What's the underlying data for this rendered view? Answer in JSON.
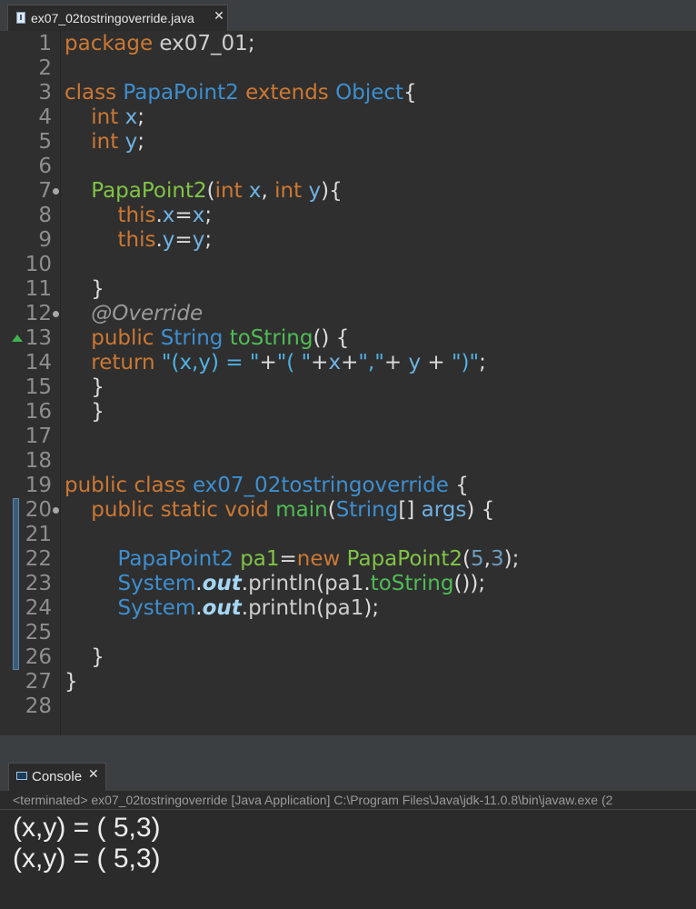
{
  "editor": {
    "tab_label": "ex07_02tostringoverride.java",
    "close_glyph": "✕",
    "lines": [
      {
        "n": "1",
        "tokens": [
          [
            "kw",
            "package"
          ],
          [
            "pl",
            " "
          ],
          [
            "id",
            "ex07_01"
          ],
          [
            "pl",
            ";"
          ]
        ]
      },
      {
        "n": "2",
        "tokens": []
      },
      {
        "n": "3",
        "tokens": [
          [
            "kw",
            "class"
          ],
          [
            "pl",
            " "
          ],
          [
            "cls",
            "PapaPoint2"
          ],
          [
            "pl",
            " "
          ],
          [
            "kw",
            "extends"
          ],
          [
            "pl",
            " "
          ],
          [
            "cls",
            "Object"
          ],
          [
            "pl",
            "{"
          ]
        ]
      },
      {
        "n": "4",
        "tokens": [
          [
            "pl",
            "    "
          ],
          [
            "kw",
            "int"
          ],
          [
            "pl",
            " "
          ],
          [
            "fld",
            "x"
          ],
          [
            "pl",
            ";"
          ]
        ]
      },
      {
        "n": "5",
        "tokens": [
          [
            "pl",
            "    "
          ],
          [
            "kw",
            "int"
          ],
          [
            "pl",
            " "
          ],
          [
            "fld",
            "y"
          ],
          [
            "pl",
            ";"
          ]
        ]
      },
      {
        "n": "6",
        "tokens": []
      },
      {
        "n": "7",
        "tokens": [
          [
            "pl",
            "    "
          ],
          [
            "ctor",
            "PapaPoint2"
          ],
          [
            "pl",
            "("
          ],
          [
            "kw",
            "int"
          ],
          [
            "pl",
            " "
          ],
          [
            "fld",
            "x"
          ],
          [
            "pl",
            ", "
          ],
          [
            "kw",
            "int"
          ],
          [
            "pl",
            " "
          ],
          [
            "fld",
            "y"
          ],
          [
            "pl",
            "){"
          ]
        ]
      },
      {
        "n": "8",
        "tokens": [
          [
            "pl",
            "        "
          ],
          [
            "kw",
            "this"
          ],
          [
            "pl",
            "."
          ],
          [
            "fld",
            "x"
          ],
          [
            "pl",
            "="
          ],
          [
            "fld",
            "x"
          ],
          [
            "pl",
            ";"
          ]
        ]
      },
      {
        "n": "9",
        "tokens": [
          [
            "pl",
            "        "
          ],
          [
            "kw",
            "this"
          ],
          [
            "pl",
            "."
          ],
          [
            "fld",
            "y"
          ],
          [
            "pl",
            "="
          ],
          [
            "fld",
            "y"
          ],
          [
            "pl",
            ";"
          ]
        ]
      },
      {
        "n": "10",
        "tokens": []
      },
      {
        "n": "11",
        "tokens": [
          [
            "pl",
            "    }"
          ]
        ]
      },
      {
        "n": "12",
        "tokens": [
          [
            "pl",
            "    "
          ],
          [
            "ann",
            "@Override"
          ]
        ]
      },
      {
        "n": "13",
        "tokens": [
          [
            "pl",
            "    "
          ],
          [
            "kw",
            "public"
          ],
          [
            "pl",
            " "
          ],
          [
            "cls",
            "String"
          ],
          [
            "pl",
            " "
          ],
          [
            "mth",
            "toString"
          ],
          [
            "pl",
            "() {"
          ]
        ]
      },
      {
        "n": "14",
        "tokens": [
          [
            "pl",
            "    "
          ],
          [
            "kw",
            "return"
          ],
          [
            "pl",
            " "
          ],
          [
            "str",
            "\"(x,y) = \""
          ],
          [
            "pl",
            "+"
          ],
          [
            "str",
            "\"( \""
          ],
          [
            "pl",
            "+"
          ],
          [
            "fld",
            "x"
          ],
          [
            "pl",
            "+"
          ],
          [
            "str",
            "\",\""
          ],
          [
            "pl",
            "+ "
          ],
          [
            "fld",
            "y"
          ],
          [
            "pl",
            " + "
          ],
          [
            "str",
            "\")\""
          ],
          [
            "pl",
            ";"
          ]
        ]
      },
      {
        "n": "15",
        "tokens": [
          [
            "pl",
            "    }"
          ]
        ]
      },
      {
        "n": "16",
        "tokens": [
          [
            "pl",
            "    }"
          ]
        ]
      },
      {
        "n": "17",
        "tokens": []
      },
      {
        "n": "18",
        "tokens": []
      },
      {
        "n": "19",
        "tokens": [
          [
            "kw",
            "public"
          ],
          [
            "pl",
            " "
          ],
          [
            "kw",
            "class"
          ],
          [
            "pl",
            " "
          ],
          [
            "cls",
            "ex07_02tostringoverride"
          ],
          [
            "pl",
            " {"
          ]
        ]
      },
      {
        "n": "20",
        "tokens": [
          [
            "pl",
            "    "
          ],
          [
            "kw",
            "public"
          ],
          [
            "pl",
            " "
          ],
          [
            "kw",
            "static"
          ],
          [
            "pl",
            " "
          ],
          [
            "kw",
            "void"
          ],
          [
            "pl",
            " "
          ],
          [
            "mth",
            "main"
          ],
          [
            "pl",
            "("
          ],
          [
            "cls",
            "String"
          ],
          [
            "pl",
            "[] "
          ],
          [
            "fld",
            "args"
          ],
          [
            "pl",
            ") {"
          ]
        ]
      },
      {
        "n": "21",
        "tokens": []
      },
      {
        "n": "22",
        "tokens": [
          [
            "pl",
            "        "
          ],
          [
            "cls",
            "PapaPoint2"
          ],
          [
            "pl",
            " "
          ],
          [
            "ctor",
            "pa1"
          ],
          [
            "pl",
            "="
          ],
          [
            "kw",
            "new"
          ],
          [
            "pl",
            " "
          ],
          [
            "ctor",
            "PapaPoint2"
          ],
          [
            "pl",
            "("
          ],
          [
            "num",
            "5"
          ],
          [
            "pl",
            ","
          ],
          [
            "num",
            "3"
          ],
          [
            "pl",
            ");"
          ]
        ]
      },
      {
        "n": "23",
        "tokens": [
          [
            "pl",
            "        "
          ],
          [
            "cls",
            "System"
          ],
          [
            "pl",
            "."
          ],
          [
            "sout",
            "out"
          ],
          [
            "pl",
            "."
          ],
          [
            "id",
            "println"
          ],
          [
            "pl",
            "("
          ],
          [
            "id",
            "pa1"
          ],
          [
            "pl",
            "."
          ],
          [
            "mth",
            "toString"
          ],
          [
            "pl",
            "());"
          ]
        ]
      },
      {
        "n": "24",
        "tokens": [
          [
            "pl",
            "        "
          ],
          [
            "cls",
            "System"
          ],
          [
            "pl",
            "."
          ],
          [
            "sout",
            "out"
          ],
          [
            "pl",
            "."
          ],
          [
            "id",
            "println"
          ],
          [
            "pl",
            "("
          ],
          [
            "id",
            "pa1"
          ],
          [
            "pl",
            ");"
          ]
        ]
      },
      {
        "n": "25",
        "tokens": []
      },
      {
        "n": "26",
        "tokens": [
          [
            "pl",
            "    }"
          ]
        ]
      },
      {
        "n": "27",
        "tokens": [
          [
            "pl",
            "}"
          ]
        ]
      },
      {
        "n": "28",
        "tokens": []
      }
    ],
    "fold_lines": [
      "7",
      "12",
      "20"
    ],
    "override_marker_line": "13",
    "current_line": "25",
    "scroll_left_glyph": "<"
  },
  "console": {
    "tab_label": "Console",
    "close_glyph": "✕",
    "status": "<terminated> ex07_02tostringoverride [Java Application] C:\\Program Files\\Java\\jdk-11.0.8\\bin\\javaw.exe  (2",
    "output": [
      "(x,y) = ( 5,3)",
      "(x,y) = ( 5,3)"
    ]
  },
  "colors": {
    "keyword": "#cc7832",
    "class": "#3d8fd0",
    "method": "#4fbc55",
    "field": "#6fb2e3",
    "background": "#2b2b2b"
  },
  "icons": {
    "tab_file": "java-file-icon",
    "console": "console-icon",
    "override": "override-triangle-icon",
    "fold": "fold-collapse-icon"
  }
}
